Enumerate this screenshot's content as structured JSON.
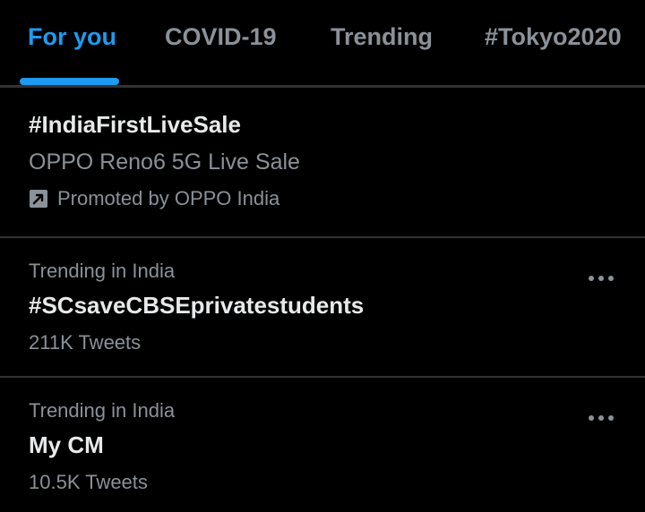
{
  "tabs": [
    {
      "label": "For you",
      "active": true
    },
    {
      "label": "COVID-19",
      "active": false
    },
    {
      "label": "Trending",
      "active": false
    },
    {
      "label": "#Tokyo2020",
      "active": false
    }
  ],
  "promoted": {
    "title": "#IndiaFirstLiveSale",
    "subtitle": "OPPO Reno6 5G Live Sale",
    "promoted_label": "Promoted by OPPO India",
    "icon": "promoted-arrow-icon"
  },
  "trends": [
    {
      "context": "Trending in India",
      "title": "#SCsaveCBSEprivatestudents",
      "tweets": "211K Tweets",
      "menu_icon": "more-options-icon"
    },
    {
      "context": "Trending in India",
      "title": "My CM",
      "tweets": "10.5K Tweets",
      "menu_icon": "more-options-icon"
    }
  ],
  "colors": {
    "background": "#000000",
    "accent": "#1d9bf0",
    "primary_text": "#e7e9ea",
    "secondary_text": "#8b9198",
    "divider": "#2f3336"
  }
}
